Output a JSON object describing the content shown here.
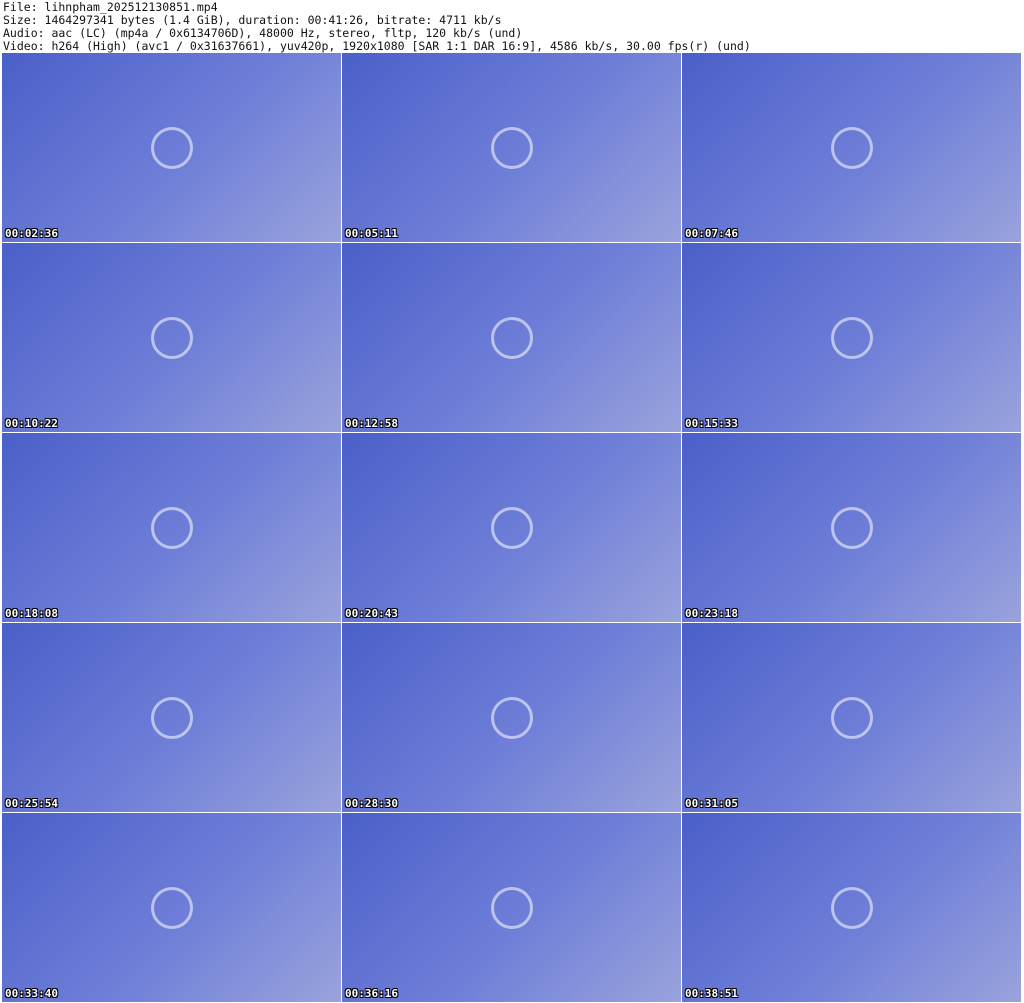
{
  "header": {
    "file": "File: lihnpham_202512130851.mp4",
    "size": "Size: 1464297341 bytes (1.4 GiB), duration: 00:41:26, bitrate: 4711 kb/s",
    "audio": "Audio: aac (LC) (mp4a / 0x6134706D), 48000 Hz, stereo, fltp, 120 kb/s (und)",
    "video": "Video: h264 (High) (avc1 / 0x31637661), yuv420p, 1920x1080 [SAR 1:1 DAR 16:9], 4586 kb/s, 30.00 fps(r) (und)"
  },
  "thumbnails": [
    {
      "time": "00:02:36"
    },
    {
      "time": "00:05:11"
    },
    {
      "time": "00:07:46"
    },
    {
      "time": "00:10:22"
    },
    {
      "time": "00:12:58"
    },
    {
      "time": "00:15:33"
    },
    {
      "time": "00:18:08"
    },
    {
      "time": "00:20:43"
    },
    {
      "time": "00:23:18"
    },
    {
      "time": "00:25:54"
    },
    {
      "time": "00:28:30"
    },
    {
      "time": "00:31:05"
    },
    {
      "time": "00:33:40"
    },
    {
      "time": "00:36:16"
    },
    {
      "time": "00:38:51"
    }
  ]
}
